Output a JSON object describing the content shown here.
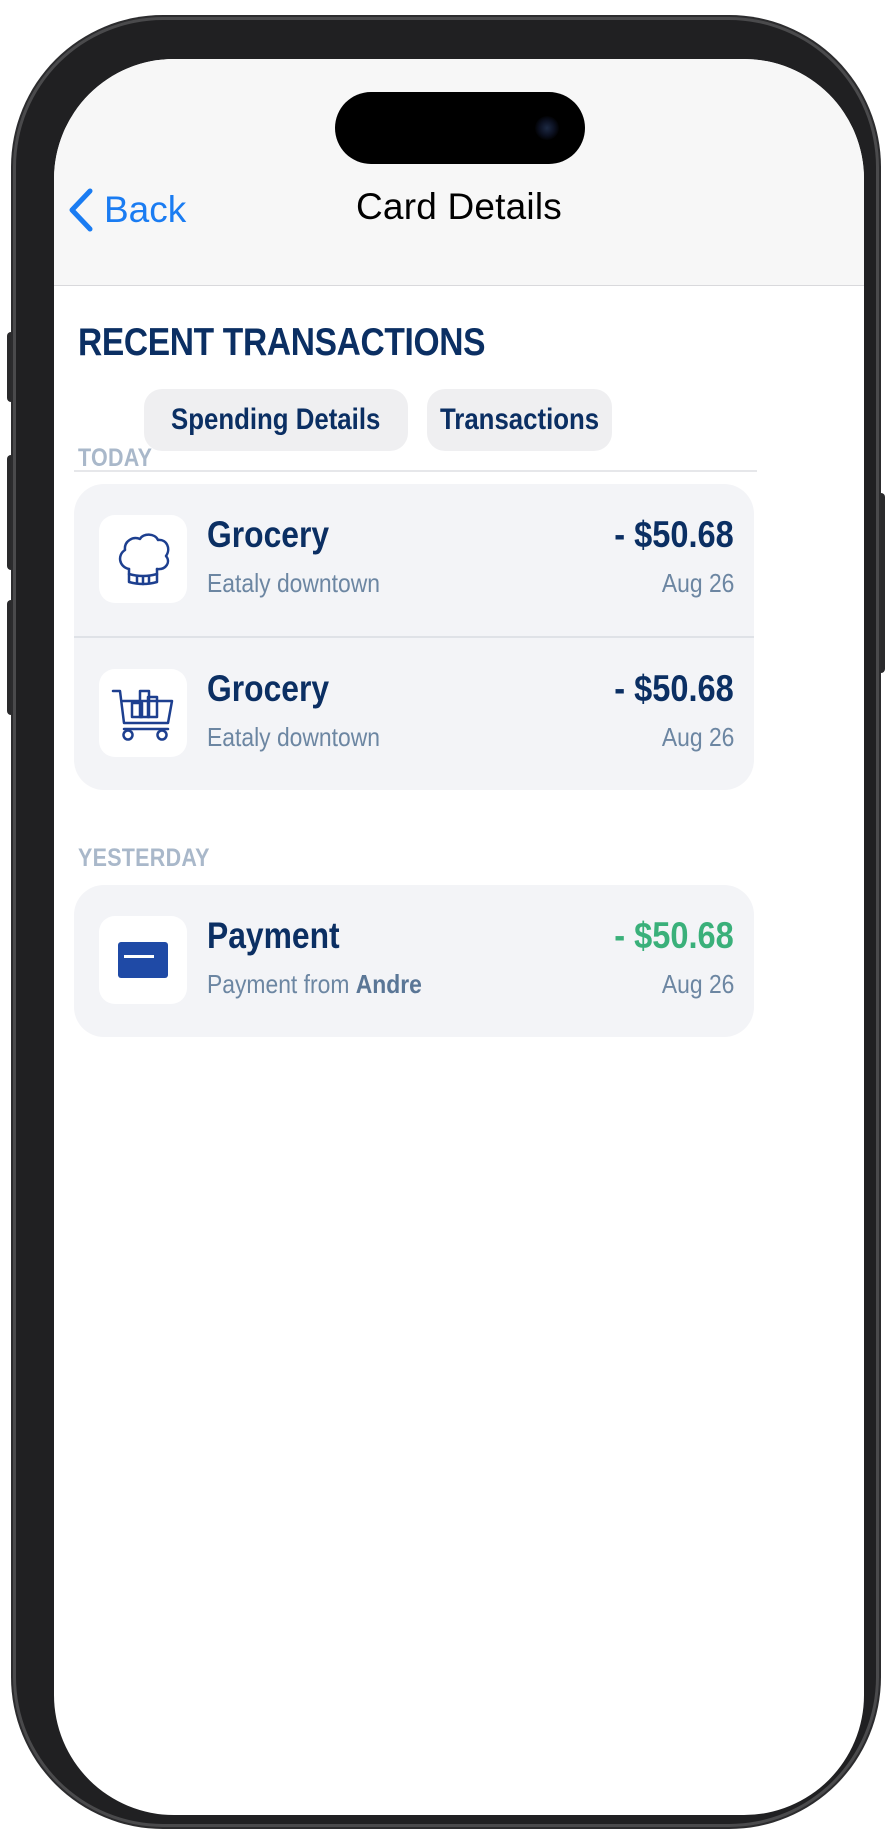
{
  "nav": {
    "back_label": "Back",
    "title": "Card Details"
  },
  "heading": "RECENT TRANSACTIONS",
  "tabs": [
    {
      "label": "Spending Details"
    },
    {
      "label": "Transactions"
    }
  ],
  "sections": [
    {
      "label": "TODAY",
      "items": [
        {
          "icon": "chef-hat-icon",
          "title": "Grocery",
          "subtitle": "Eataly downtown",
          "amount": "- $50.68",
          "date": "Aug 26"
        },
        {
          "icon": "shopping-cart-icon",
          "title": "Grocery",
          "subtitle": "Eataly downtown",
          "amount": "- $50.68",
          "date": "Aug 26"
        }
      ]
    },
    {
      "label": "YESTERDAY",
      "items": [
        {
          "icon": "credit-card-icon",
          "title": "Payment",
          "subtitle_prefix": "Payment from",
          "subtitle_name": "Andre",
          "amount": "- $50.68",
          "date": "Aug 26"
        }
      ]
    }
  ],
  "colors": {
    "brand_navy": "#0b2f63",
    "link_blue": "#1a7cf2",
    "positive_green": "#3ab07a",
    "muted_label": "#a9b8ca"
  }
}
